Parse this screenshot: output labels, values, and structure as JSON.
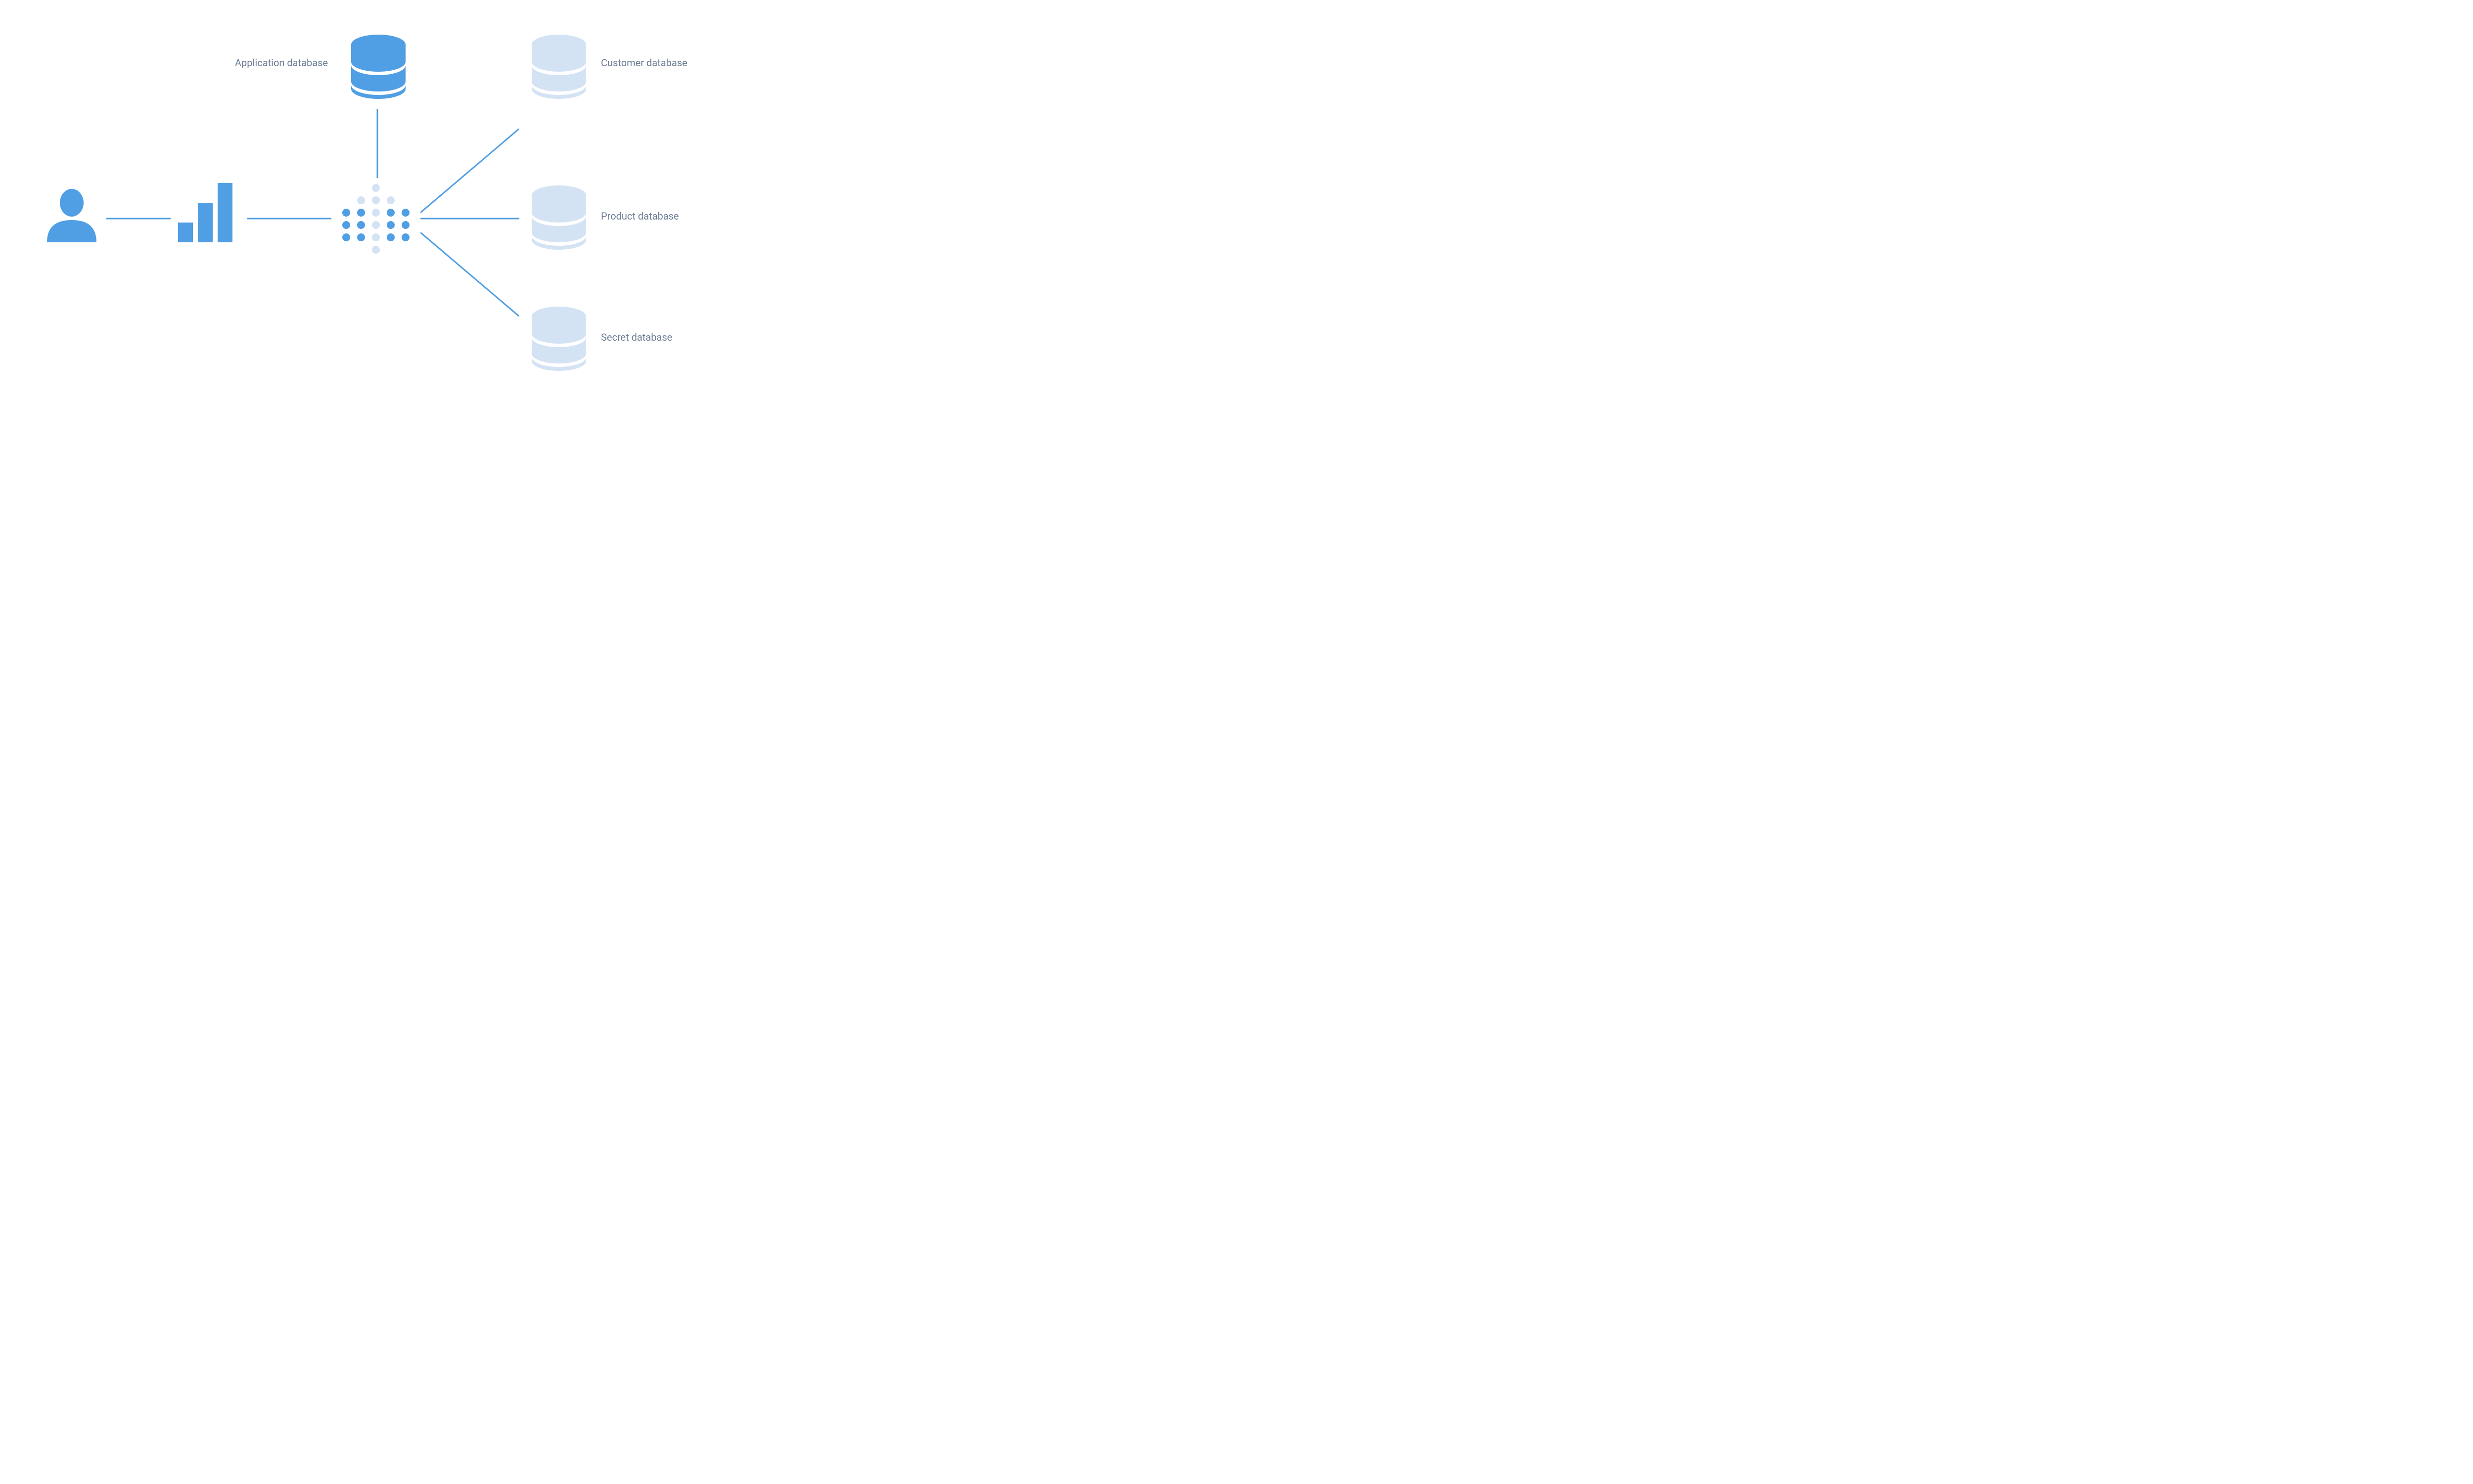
{
  "colors": {
    "primary": "#509ee3",
    "faded": "#d4e3f4",
    "text": "#6b7c93"
  },
  "labels": {
    "application_db": "Application database",
    "customer_db": "Customer database",
    "product_db": "Product database",
    "secret_db": "Secret database"
  }
}
